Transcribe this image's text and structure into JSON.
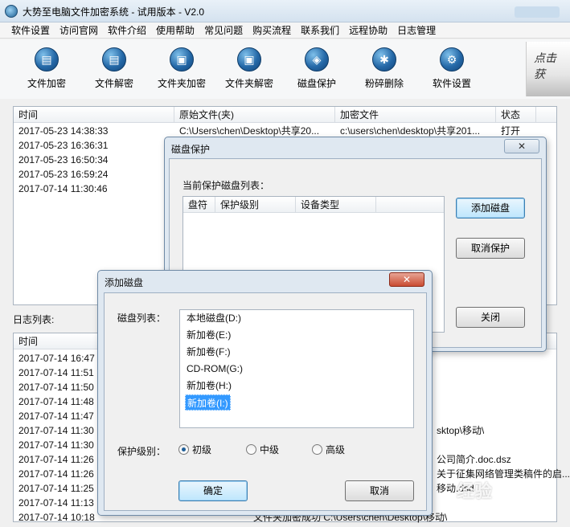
{
  "window": {
    "title": "大势至电脑文件加密系统 - 试用版本 - V2.0"
  },
  "menu": [
    "软件设置",
    "访问官网",
    "软件介绍",
    "使用帮助",
    "常见问题",
    "购买流程",
    "联系我们",
    "远程协助",
    "日志管理"
  ],
  "toolbar": [
    {
      "label": "文件加密",
      "icon": "file-lock-icon",
      "glyph": "▤"
    },
    {
      "label": "文件解密",
      "icon": "file-unlock-icon",
      "glyph": "▤"
    },
    {
      "label": "文件夹加密",
      "icon": "folder-lock-icon",
      "glyph": "▣"
    },
    {
      "label": "文件夹解密",
      "icon": "folder-unlock-icon",
      "glyph": "▣"
    },
    {
      "label": "磁盘保护",
      "icon": "disk-shield-icon",
      "glyph": "◈"
    },
    {
      "label": "粉碎删除",
      "icon": "shred-icon",
      "glyph": "✱"
    },
    {
      "label": "软件设置",
      "icon": "gear-icon",
      "glyph": "⚙"
    }
  ],
  "promo": {
    "text": "点击 获"
  },
  "file_list": {
    "columns": [
      "时间",
      "原始文件(夹)",
      "加密文件",
      "状态"
    ],
    "rows": [
      [
        "2017-05-23 14:38:33",
        "C:\\Users\\chen\\Desktop\\共享20...",
        "c:\\users\\chen\\desktop\\共享201...",
        "打开"
      ],
      [
        "2017-05-23 16:36:31",
        "",
        "",
        ""
      ],
      [
        "2017-05-23 16:50:34",
        "",
        "",
        ""
      ],
      [
        "2017-05-23 16:59:24",
        "",
        "",
        ""
      ],
      [
        "2017-07-14 11:30:46",
        "",
        "",
        ""
      ]
    ]
  },
  "log": {
    "label": "日志列表:",
    "column": "时间",
    "rows": [
      {
        "time": "2017-07-14 16:47",
        "detail": ""
      },
      {
        "time": "2017-07-14 11:51",
        "detail": ""
      },
      {
        "time": "2017-07-14 11:50",
        "detail": ""
      },
      {
        "time": "2017-07-14 11:48",
        "detail": ""
      },
      {
        "time": "2017-07-14 11:47",
        "detail": ""
      },
      {
        "time": "2017-07-14 11:30",
        "detail": "sktop\\移动\\"
      },
      {
        "time": "2017-07-14 11:30",
        "detail": ""
      },
      {
        "time": "2017-07-14 11:26",
        "detail": "公司简介.doc.dsz"
      },
      {
        "time": "2017-07-14 11:26",
        "detail": "关于征集网络管理类稿件的启..."
      },
      {
        "time": "2017-07-14 11:25",
        "detail": "移动.dsd"
      },
      {
        "time": "2017-07-14 11:13",
        "detail": ""
      },
      {
        "time": "2017-07-14 10:18",
        "detail": "文件夹加密成功    C:\\Users\\chen\\Desktop\\移动\\"
      }
    ]
  },
  "protect_dialog": {
    "title": "磁盘保护",
    "close": "✕",
    "caption": "当前保护磁盘列表：",
    "columns": [
      "盘符",
      "保护级别",
      "设备类型"
    ],
    "add_button": "添加磁盘",
    "cancel_button": "取消保护",
    "close_button": "关闭"
  },
  "add_dialog": {
    "title": "添加磁盘",
    "close": "✕",
    "disk_label": "磁盘列表：",
    "disks": [
      "本地磁盘(D:)",
      "新加卷(E:)",
      "新加卷(F:)",
      "CD-ROM(G:)",
      "新加卷(H:)",
      "新加卷(I:)"
    ],
    "selected_disk": 5,
    "level_label": "保护级别：",
    "levels": [
      "初级",
      "中级",
      "高级"
    ],
    "selected_level": 0,
    "ok_button": "确定",
    "cancel_button": "取消"
  },
  "watermark": "经验"
}
